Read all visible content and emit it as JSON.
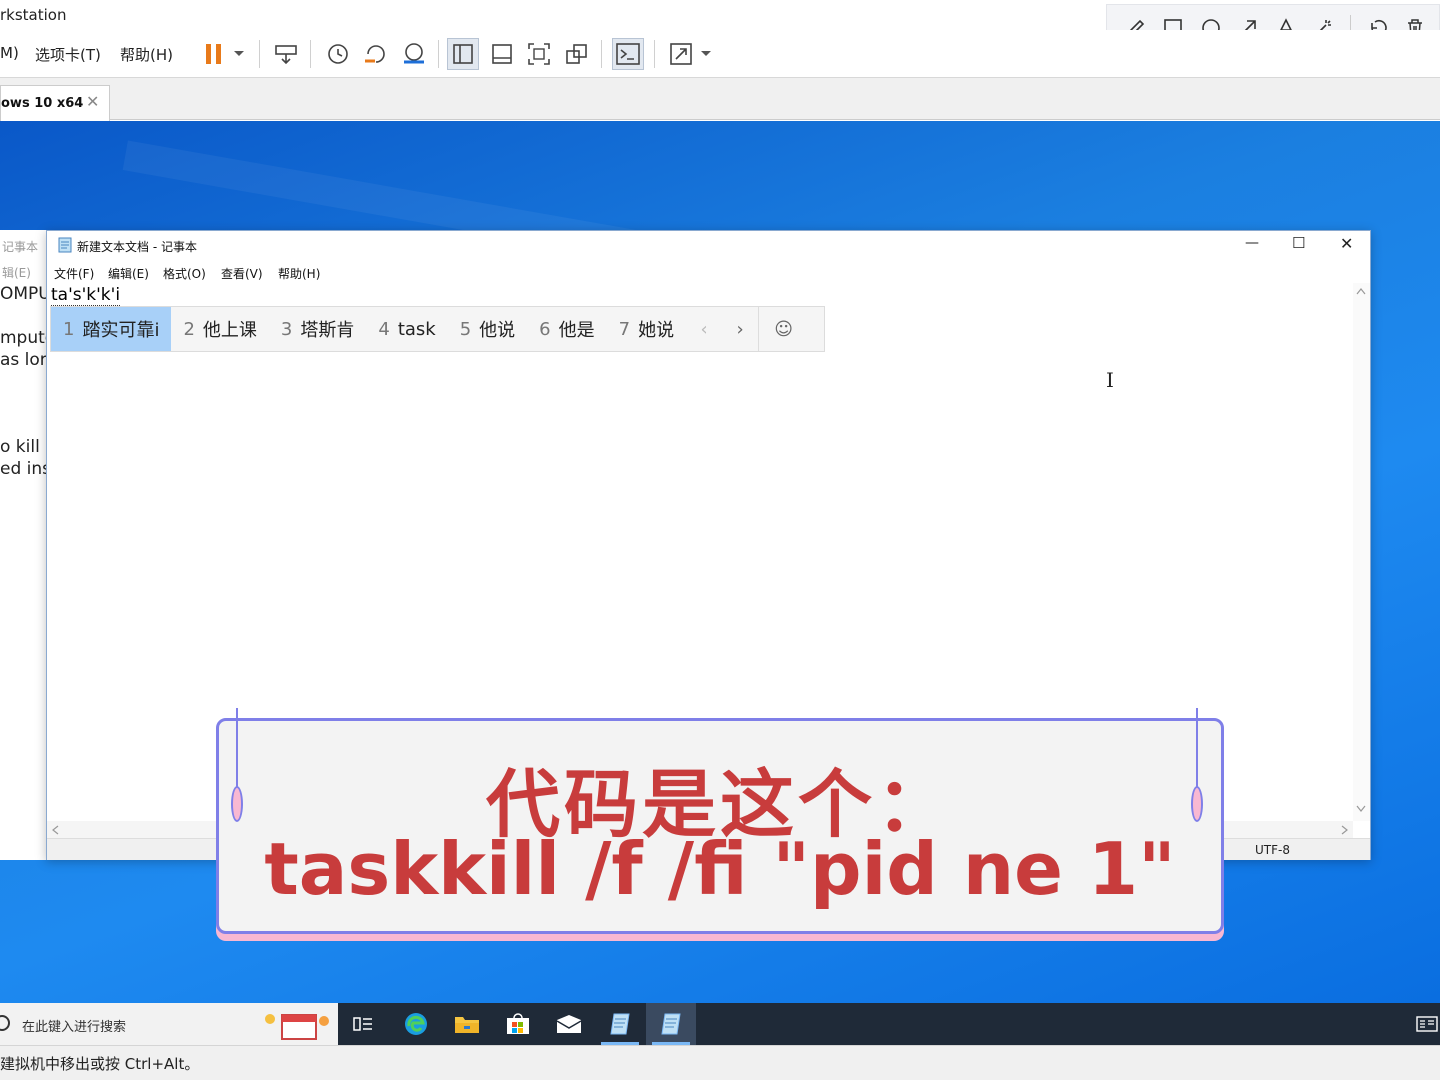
{
  "host": {
    "title": "rkstation",
    "menu": [
      "M)",
      "选项卡(T)",
      "帮助(H)"
    ],
    "tab_label": "ows 10 x64",
    "tab_close": "✕",
    "status_message": "建拟机中移出或按 Ctrl+Alt。",
    "colors": {
      "pause": "#e87a1a",
      "accent": "#1e6fd8"
    },
    "annotation_tools": [
      "pencil-icon",
      "rectangle-icon",
      "circle-icon",
      "arrow-icon",
      "text-icon",
      "magic-wand-icon",
      "undo-icon",
      "trash-icon"
    ]
  },
  "background_notepad": {
    "title": "记事本",
    "menu": "辑(E)",
    "lines": [
      "OMPU",
      "mpute",
      " as lor",
      "o kill M",
      "ed inst"
    ]
  },
  "notepad": {
    "title": "新建文本文档 - 记事本",
    "menu": [
      "文件(F)",
      "编辑(E)",
      "格式(O)",
      "查看(V)",
      "帮助(H)"
    ],
    "content": "ta's'k'k'i",
    "encoding": "UTF-8",
    "controls": {
      "minimize": "—",
      "maximize": "☐",
      "close": "✕"
    }
  },
  "ime": {
    "candidates": [
      {
        "num": "1",
        "text": "踏实可靠i"
      },
      {
        "num": "2",
        "text": "他上课"
      },
      {
        "num": "3",
        "text": "塔斯肯"
      },
      {
        "num": "4",
        "text": "task"
      },
      {
        "num": "5",
        "text": "他说"
      },
      {
        "num": "6",
        "text": "他是"
      },
      {
        "num": "7",
        "text": "她说"
      }
    ],
    "prev": "‹",
    "next": "›",
    "emoji": "☺"
  },
  "caption": {
    "line1": "代码是这个：",
    "line2": "taskkill /f /fi \"pid ne 1\""
  },
  "taskbar": {
    "search_placeholder": "在此键入进行搜索",
    "apps": [
      "task-view-icon",
      "edge-icon",
      "file-explorer-icon",
      "store-icon",
      "mail-icon",
      "notepad-icon",
      "notepad-icon"
    ]
  }
}
